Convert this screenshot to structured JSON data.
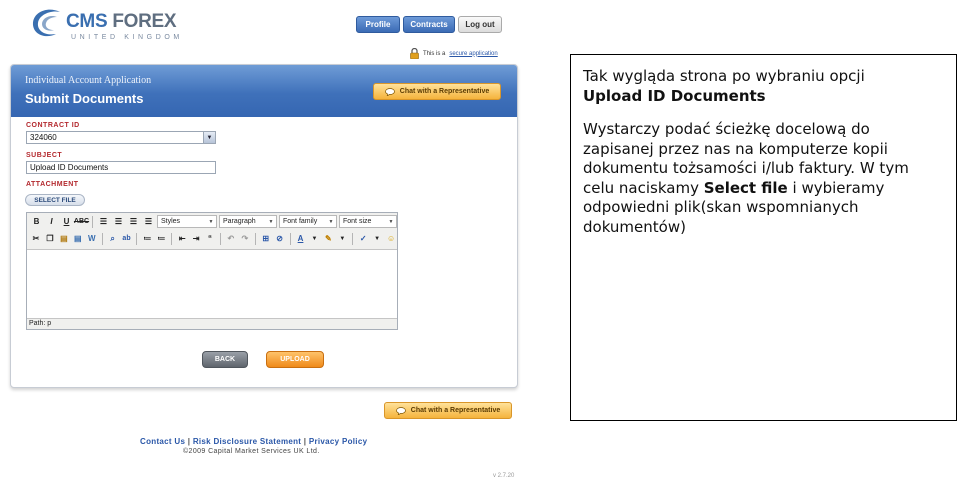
{
  "logo": {
    "main_a": "CMS",
    "main_b": "FOREX",
    "sub": "UNITED KINGDOM"
  },
  "nav": [
    {
      "label": "Profile",
      "style": "blue"
    },
    {
      "label": "Contracts",
      "style": "blue"
    },
    {
      "label": "Log out",
      "style": "gray"
    }
  ],
  "secure": {
    "prefix": "This is a",
    "link": "secure application"
  },
  "panel": {
    "supertitle": "Individual Account Application",
    "title": "Submit Documents",
    "chat_label": "Chat with a Representative",
    "contract_label": "CONTRACT ID",
    "contract_value": "324060",
    "subject_label": "SUBJECT",
    "subject_value": "Upload ID Documents",
    "attachment_label": "ATTACHMENT",
    "select_file": "SELECT FILE"
  },
  "editor": {
    "styles": "Styles",
    "paragraph": "Paragraph",
    "font_family": "Font family",
    "font_size": "Font size",
    "path": "Path: p"
  },
  "buttons": {
    "back": "BACK",
    "upload": "UPLOAD"
  },
  "bottom_chat": "Chat with a Representative",
  "footer": {
    "contact": "Contact Us",
    "risk": "Risk Disclosure Statement",
    "privacy": "Privacy Policy",
    "copyright": "©2009 Capital Market Services UK Ltd.",
    "version": "v 2.7.20"
  },
  "note": {
    "line1_a": "Tak wygląda strona po wybraniu  opcji",
    "line1_b": "Upload ID Documents",
    "p2_a": "Wystarczy podać ścieżkę docelową do zapisanej przez nas na komputerze kopii dokumentu tożsamości i/lub faktury. W tym celu naciskamy ",
    "p2_bold": "Select file",
    "p2_b": " i wybieramy odpowiedni plik(skan wspomnianych dokumentów)"
  },
  "colors": {
    "header_blue": "#3f71ba",
    "label_red": "#b3282d",
    "chat_orange": "#f5b33c",
    "upload_orange": "#f08a1a"
  }
}
